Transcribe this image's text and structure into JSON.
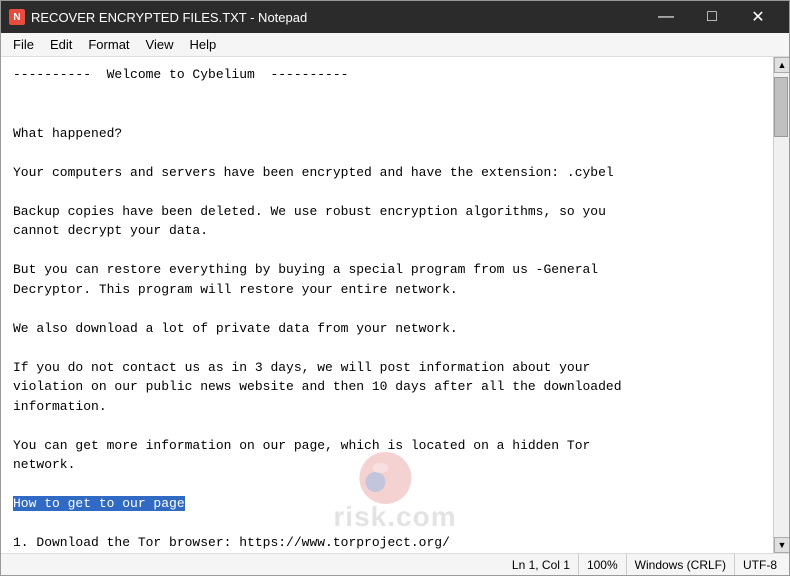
{
  "window": {
    "title": "RECOVER ENCRYPTED FILES.TXT - Notepad",
    "icon_label": "N"
  },
  "title_controls": {
    "minimize": "—",
    "maximize": "□",
    "close": "✕"
  },
  "menu": {
    "items": [
      "File",
      "Edit",
      "Format",
      "View",
      "Help"
    ]
  },
  "content": {
    "text": "----------  Welcome to Cybelium  ----------\n\n\nWhat happened?\n\nYour computers and servers have been encrypted and have the extension: .cybel\n\nBackup copies have been deleted. We use robust encryption algorithms, so you\ncannot decrypt your data.\n\nBut you can restore everything by buying a special program from us -General\nDecryptor. This program will restore your entire network.\n\nWe also download a lot of private data from your network.\n\nIf you do not contact us as in 3 days, we will post information about your\nviolation on our public news website and then 10 days after all the downloaded\ninformation.\n\nYou can get more information on our page, which is located on a hidden Tor\nnetwork.\n\nHow to get to our page\n\n1. Download the Tor browser: https://www.torproject.org/"
  },
  "status_bar": {
    "position": "Ln 1, Col 1",
    "zoom": "100%",
    "line_ending": "Windows (CRLF)",
    "encoding": "UTF-8"
  },
  "watermark": {
    "text": "risk.com"
  }
}
